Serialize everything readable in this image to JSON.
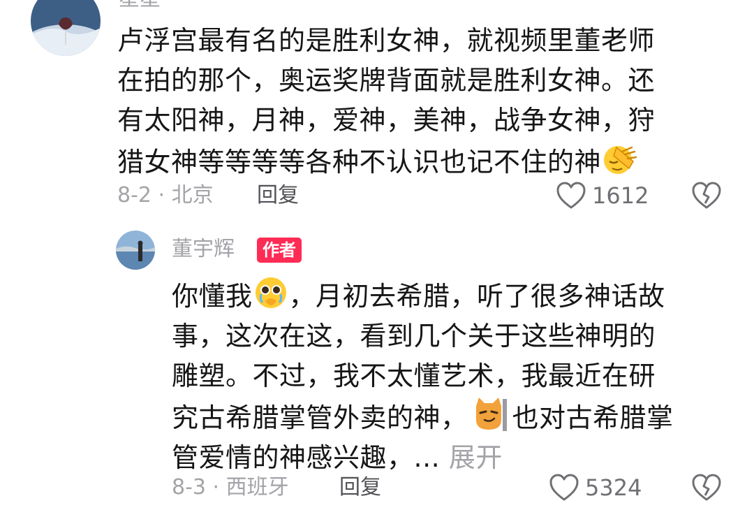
{
  "comment1": {
    "username": "星星",
    "lines": [
      "卢浮宫最有名的是胜利女神，就视频里董老师",
      "在拍的那个，奥运奖牌背面就是胜利女神。还",
      "有太阳神，月神，爱神，美神，战争女神，狩",
      "猎女神等等等等各种不认识也记不住的神"
    ],
    "emoji_icon": "facepalm-emoji",
    "date_location": "8-2 · 北京",
    "reply_label": "回复",
    "like_count": "1612"
  },
  "comment2": {
    "username": "董宇辉",
    "author_badge": "作者",
    "line1_a": "你懂我",
    "line1_b": "，月初去希腊，听了很多神话故",
    "line2": "事，这次在这，看到几个关于这些神明的",
    "line3": "雕塑。不过，我不太懂艺术，我最近在研",
    "line4_a": "究古希腊掌管外卖的神，",
    "line4_b": "也对古希腊掌",
    "line5": "管爱情的神感兴趣，... ",
    "expand_label": "展开",
    "emoji_icons": [
      "pleading-face-emoji",
      "smirking-cat-emoji"
    ],
    "date_location": "8-3 · 西班牙",
    "reply_label": "回复",
    "like_count": "5324"
  },
  "colors": {
    "primary_text": "#161616",
    "secondary_text": "#a3a3a8",
    "author_badge": "#fe2c55"
  }
}
